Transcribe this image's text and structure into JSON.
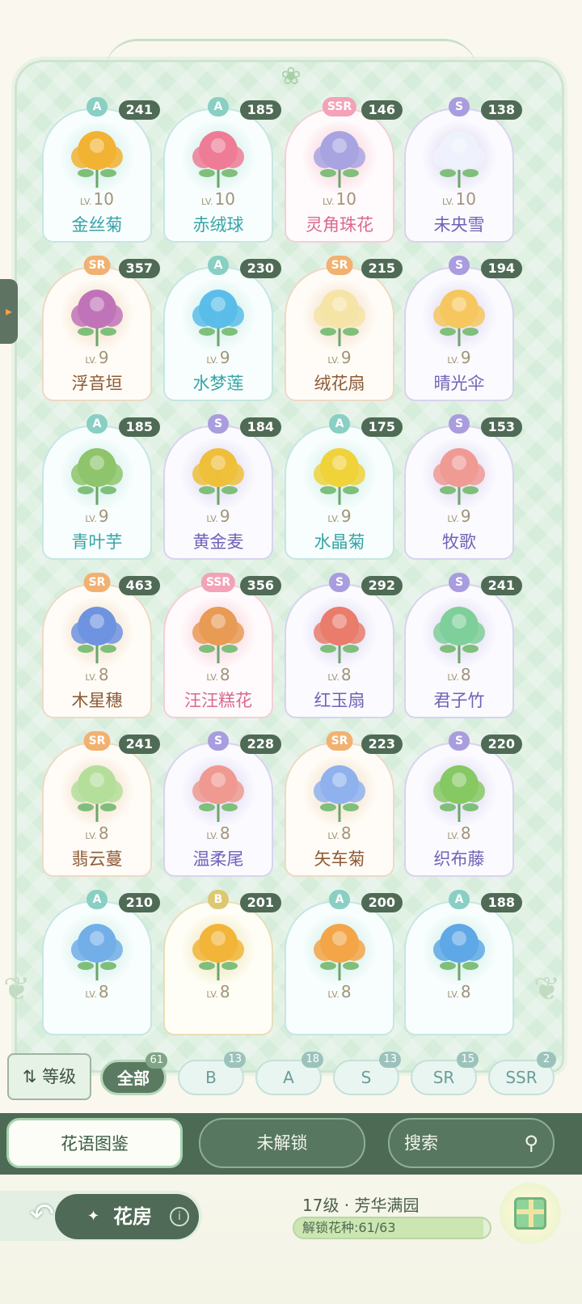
{
  "level_prefix": "LV.",
  "flowers": [
    {
      "rarity": "A",
      "count": "241",
      "lv": "10",
      "name": "金丝菊",
      "color": "#f2b233"
    },
    {
      "rarity": "A",
      "count": "185",
      "lv": "10",
      "name": "赤绒球",
      "color": "#ef7c96"
    },
    {
      "rarity": "SSR",
      "count": "146",
      "lv": "10",
      "name": "灵角珠花",
      "color": "#a8a4e2"
    },
    {
      "rarity": "S",
      "count": "138",
      "lv": "10",
      "name": "未央雪",
      "color": "#eef2fb"
    },
    {
      "rarity": "SR",
      "count": "357",
      "lv": "9",
      "name": "浮音垣",
      "color": "#c173b8"
    },
    {
      "rarity": "A",
      "count": "230",
      "lv": "9",
      "name": "水梦莲",
      "color": "#5bbde9"
    },
    {
      "rarity": "SR",
      "count": "215",
      "lv": "9",
      "name": "绒花扇",
      "color": "#f5e4a6"
    },
    {
      "rarity": "S",
      "count": "194",
      "lv": "9",
      "name": "晴光伞",
      "color": "#f6c75e"
    },
    {
      "rarity": "A",
      "count": "185",
      "lv": "9",
      "name": "青叶芋",
      "color": "#8ec46b"
    },
    {
      "rarity": "S",
      "count": "184",
      "lv": "9",
      "name": "黄金麦",
      "color": "#efbf3b"
    },
    {
      "rarity": "A",
      "count": "175",
      "lv": "9",
      "name": "水晶菊",
      "color": "#f0d23a"
    },
    {
      "rarity": "S",
      "count": "153",
      "lv": "9",
      "name": "牧歌",
      "color": "#f09a94"
    },
    {
      "rarity": "SR",
      "count": "463",
      "lv": "8",
      "name": "木星穗",
      "color": "#6e93e0"
    },
    {
      "rarity": "SSR",
      "count": "356",
      "lv": "8",
      "name": "汪汪糕花",
      "color": "#e89b55"
    },
    {
      "rarity": "S",
      "count": "292",
      "lv": "8",
      "name": "红玉扇",
      "color": "#ea7c6c"
    },
    {
      "rarity": "S",
      "count": "241",
      "lv": "8",
      "name": "君子竹",
      "color": "#7fcf9a"
    },
    {
      "rarity": "SR",
      "count": "241",
      "lv": "8",
      "name": "翡云蔓",
      "color": "#b5de9b"
    },
    {
      "rarity": "S",
      "count": "228",
      "lv": "8",
      "name": "温柔尾",
      "color": "#f09990"
    },
    {
      "rarity": "SR",
      "count": "223",
      "lv": "8",
      "name": "矢车菊",
      "color": "#8fb2ee"
    },
    {
      "rarity": "S",
      "count": "220",
      "lv": "8",
      "name": "织布藤",
      "color": "#86c963"
    },
    {
      "rarity": "A",
      "count": "210",
      "lv": "8",
      "name": "",
      "color": "#72aee8"
    },
    {
      "rarity": "B",
      "count": "201",
      "lv": "8",
      "name": "",
      "color": "#f2b53a"
    },
    {
      "rarity": "A",
      "count": "200",
      "lv": "8",
      "name": "",
      "color": "#f3a548"
    },
    {
      "rarity": "A",
      "count": "188",
      "lv": "8",
      "name": "",
      "color": "#5fa8e6"
    }
  ],
  "filters": {
    "sort_label": "等级",
    "sort_icon": "sort-arrows-icon",
    "chips": [
      {
        "label": "全部",
        "count": "61",
        "active": true
      },
      {
        "label": "B",
        "count": "13",
        "active": false
      },
      {
        "label": "A",
        "count": "18",
        "active": false
      },
      {
        "label": "S",
        "count": "13",
        "active": false
      },
      {
        "label": "SR",
        "count": "15",
        "active": false
      },
      {
        "label": "SSR",
        "count": "2",
        "active": false
      }
    ]
  },
  "tabs": {
    "catalog": "花语图鉴",
    "locked": "未解锁",
    "search": "搜索"
  },
  "footer": {
    "room": "花房",
    "garden_level": "17级 · 芳华满园",
    "unlock_text": "解锁花种:61/63",
    "unlocked": 61,
    "total": 63
  }
}
